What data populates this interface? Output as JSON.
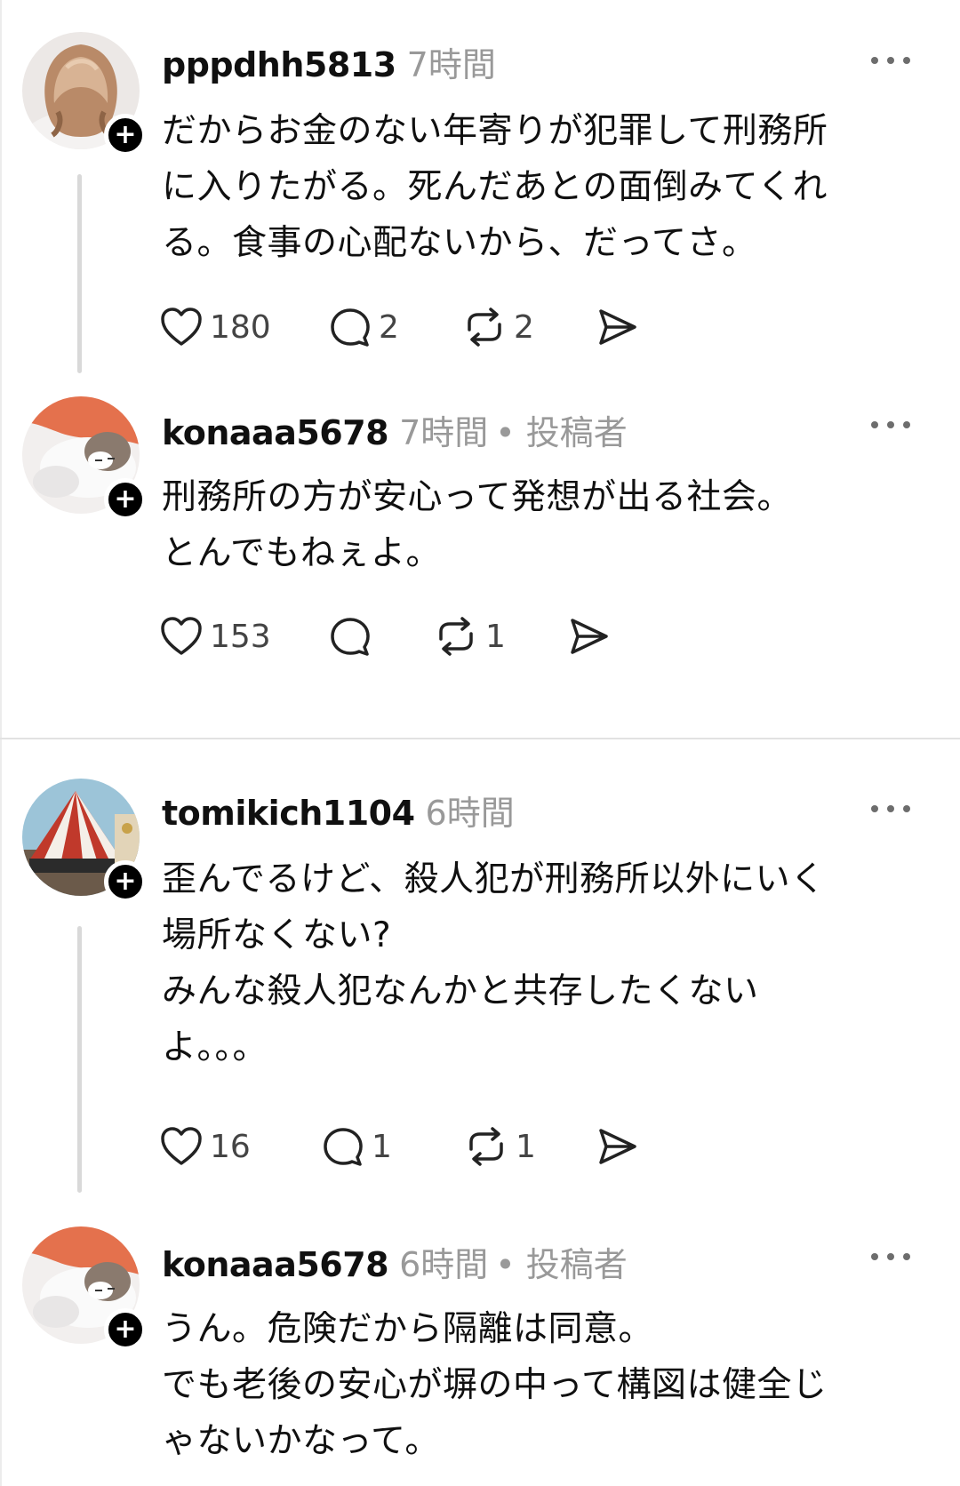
{
  "posts": [
    {
      "username": "pppdhh5813",
      "time": "7時間",
      "author_tag": "",
      "text": "だからお金のない年寄りが犯罪して刑務所\nに入りたがる。死んだあとの面倒みてくれ\nる。食事の心配ないから、だってさ。",
      "likes": "180",
      "comments": "2",
      "reposts": "2",
      "avatar": "wavy-hair-woman"
    },
    {
      "username": "konaaa5678",
      "time": "7時間",
      "author_tag": "• 投稿者",
      "text": "刑務所の方が安心って発想が出る社会。\nとんでもねぇよ。",
      "likes": "153",
      "comments": "",
      "reposts": "1",
      "avatar": "sleeping-cat"
    },
    {
      "username": "tomikich1104",
      "time": "6時間",
      "author_tag": "",
      "text": "歪んでるけど、殺人犯が刑務所以外にいく\n場所なくない?\nみんな殺人犯なんかと共存したくない\nよ。。。",
      "likes": "16",
      "comments": "1",
      "reposts": "1",
      "avatar": "circus-tent"
    },
    {
      "username": "konaaa5678",
      "time": "6時間",
      "author_tag": "• 投稿者",
      "text": "うん。危険だから隔離は同意。\nでも老後の安心が塀の中って構図は健全じ\nゃないかなって。",
      "avatar": "sleeping-cat"
    }
  ],
  "icons": {
    "like": "heart-icon",
    "comment": "comment-bubble-icon",
    "repost": "repost-icon",
    "share": "send-icon",
    "more": "more-dots-icon",
    "follow": "plus-icon"
  }
}
